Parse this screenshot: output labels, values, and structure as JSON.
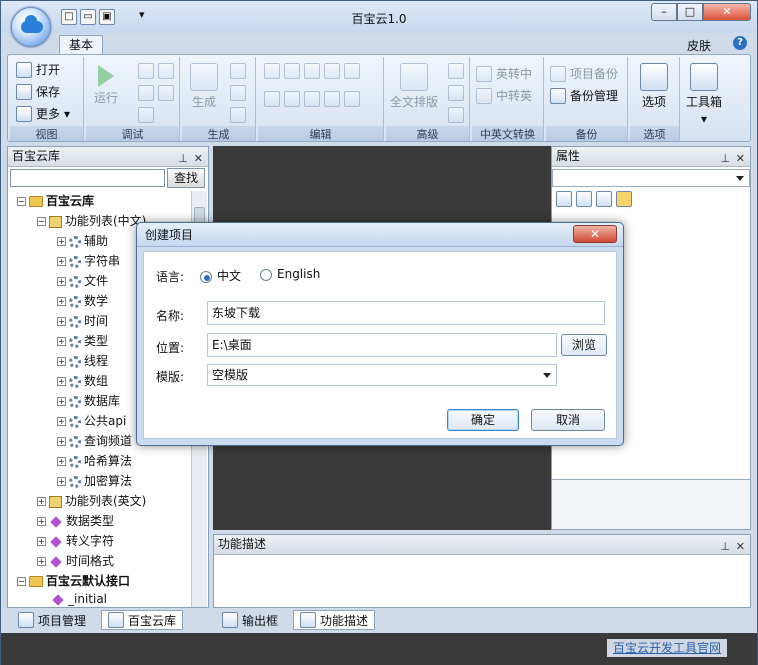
{
  "window": {
    "title": "百宝云1.0",
    "minimize": "–",
    "maximize": "□",
    "close": "✕"
  },
  "ribbon": {
    "tab": "基本",
    "skin": "皮肤",
    "help": "?",
    "groups": {
      "view": {
        "label": "视图",
        "open": "打开",
        "save": "保存",
        "more": "更多"
      },
      "debug": {
        "label": "调试",
        "run": "运行"
      },
      "build": {
        "label": "生成",
        "build": "生成"
      },
      "edit": {
        "label": "编辑"
      },
      "advanced": {
        "label": "高级",
        "format": "全文排版"
      },
      "convert": {
        "label": "中英文转换",
        "en": "英转中",
        "cn": "中转英"
      },
      "backup": {
        "label": "备份",
        "backup": "项目备份",
        "manage": "备份管理"
      },
      "options": {
        "label": "选项",
        "options": "选项"
      },
      "toolbox": {
        "label": "工具箱"
      }
    }
  },
  "library_panel": {
    "title": "百宝云库",
    "search_button": "查找",
    "root": "百宝云库",
    "func_cn": "功能列表(中文)",
    "items": [
      "辅助",
      "字符串",
      "文件",
      "数学",
      "时间",
      "类型",
      "线程",
      "数组",
      "数据库",
      "公共api",
      "查询频道",
      "哈希算法",
      "加密算法"
    ],
    "func_en": "功能列表(英文)",
    "others": [
      "数据类型",
      "转义字符",
      "时间格式"
    ],
    "default_api": "百宝云默认接口",
    "initial": "_initial"
  },
  "properties_panel": {
    "title": "属性"
  },
  "description_panel": {
    "title": "功能描述"
  },
  "bottom_tabs_left": [
    "项目管理",
    "百宝云库"
  ],
  "bottom_tabs_right": [
    "输出框",
    "功能描述"
  ],
  "status": {
    "link": "百宝云开发工具官网"
  },
  "dialog": {
    "title": "创建项目",
    "language_label": "语言:",
    "lang_cn": "中文",
    "lang_en": "English",
    "name_label": "名称:",
    "name_value": "东坡下载",
    "location_label": "位置:",
    "location_value": "E:\\桌面",
    "browse": "浏览",
    "template_label": "模版:",
    "template_value": "空模版",
    "ok": "确定",
    "cancel": "取消"
  }
}
